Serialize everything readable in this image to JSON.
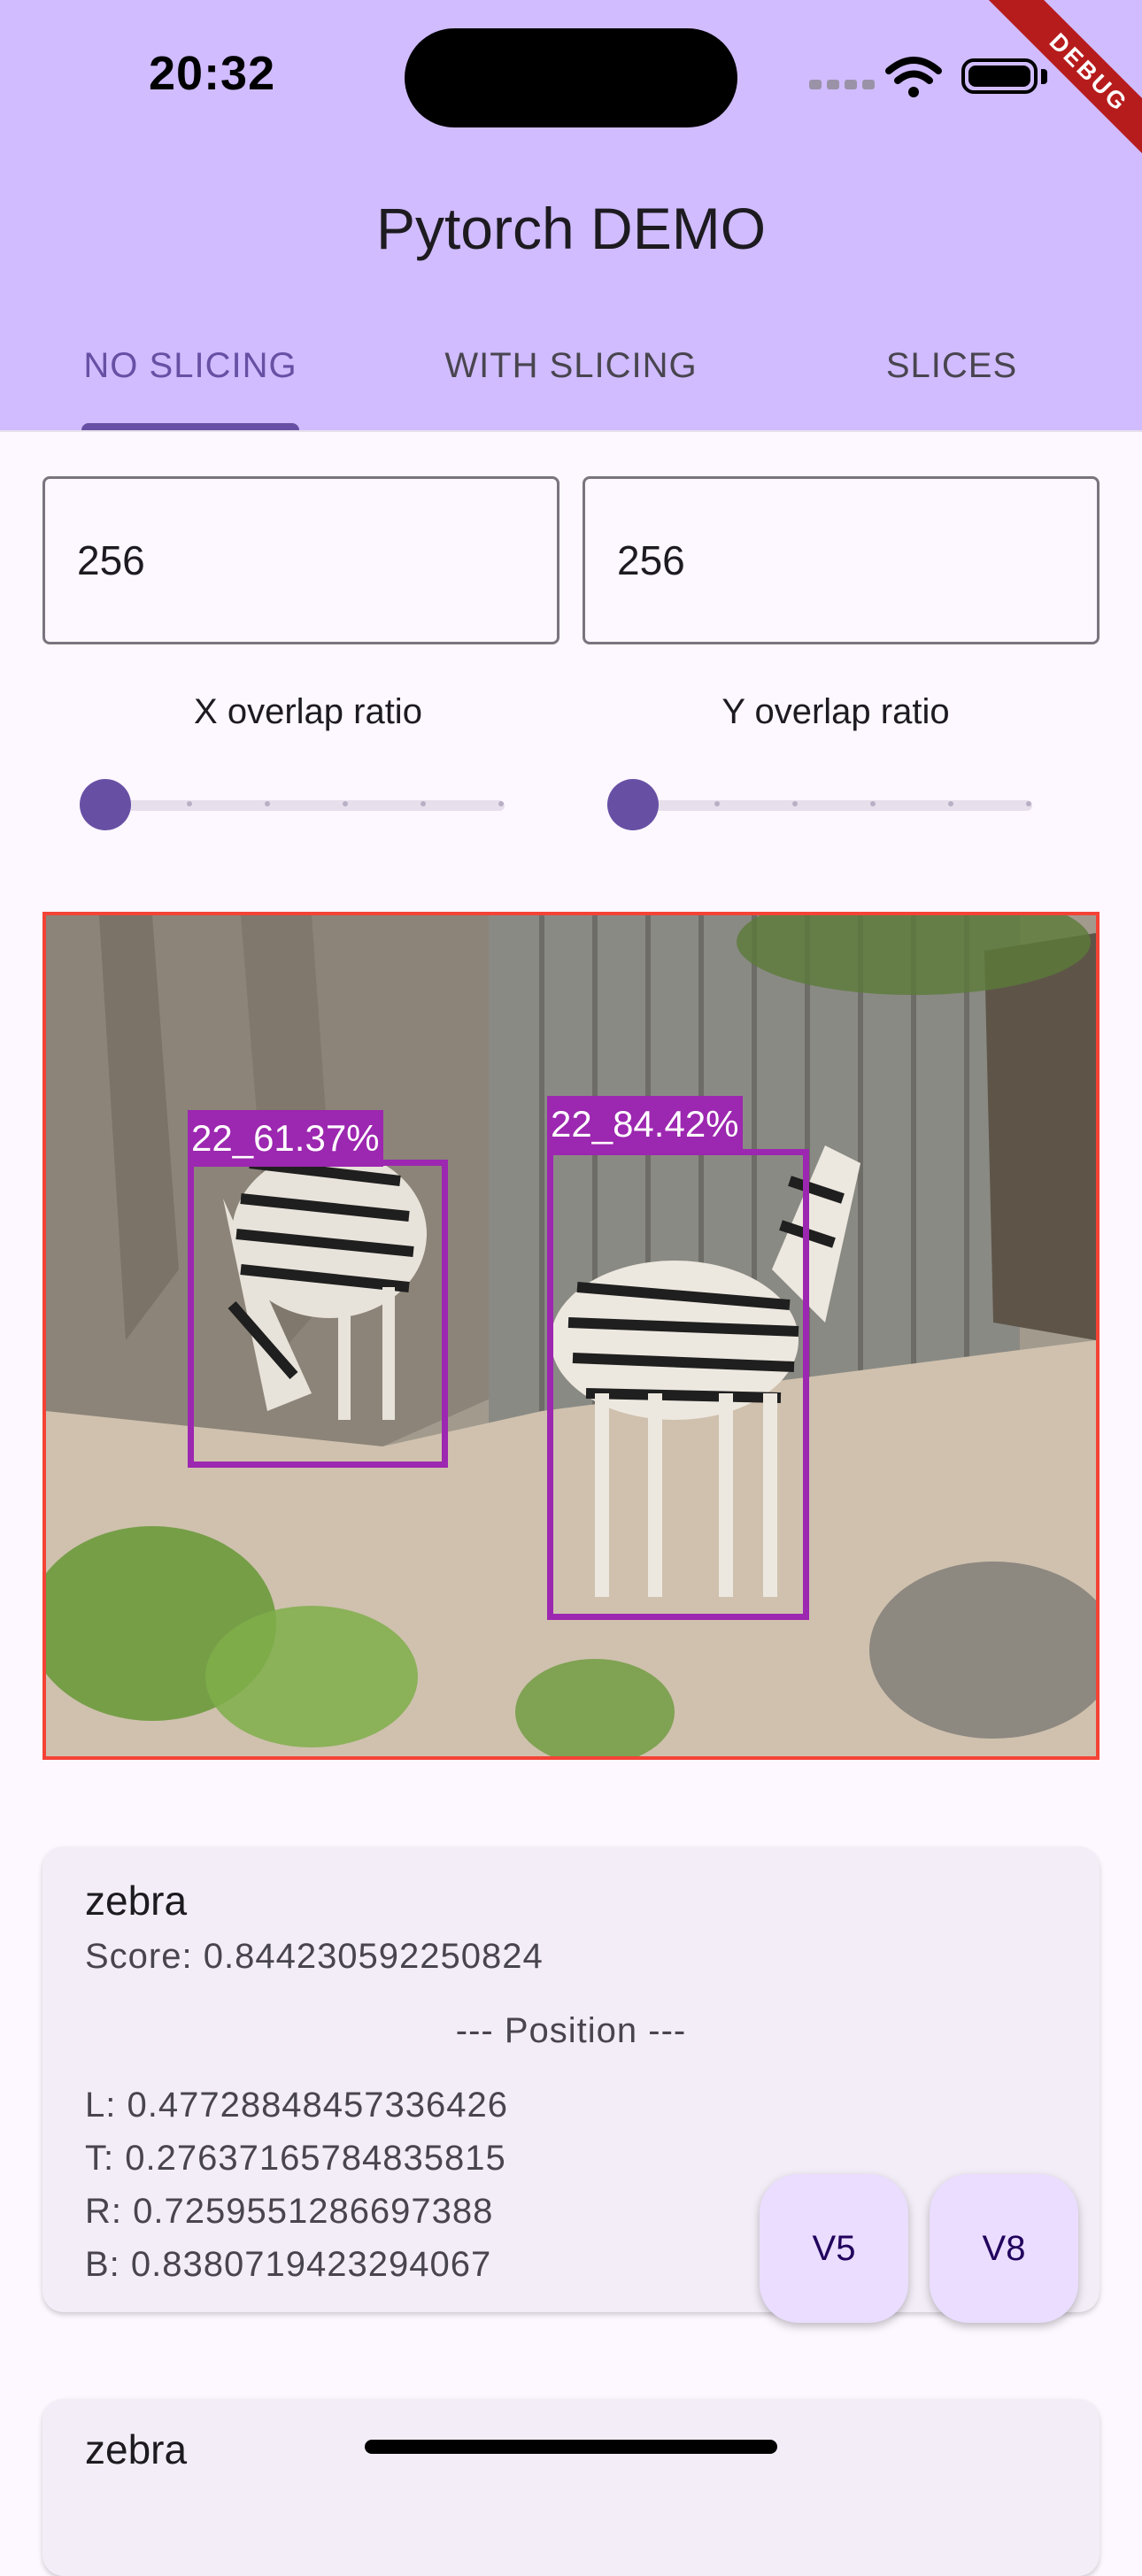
{
  "status_bar": {
    "time": "20:32"
  },
  "debug_banner": "DEBUG",
  "app_bar": {
    "title": "Pytorch DEMO"
  },
  "tabs": [
    {
      "label": "NO SLICING",
      "active": true
    },
    {
      "label": "WITH SLICING",
      "active": false
    },
    {
      "label": "SLICES",
      "active": false
    }
  ],
  "slice_width": {
    "value": "256"
  },
  "slice_height": {
    "value": "256"
  },
  "x_overlap": {
    "label": "X overlap ratio",
    "value_fraction": 0
  },
  "y_overlap": {
    "label": "Y overlap ratio",
    "value_fraction": 0
  },
  "detections": [
    {
      "label": "22_61.37%"
    },
    {
      "label": "22_84.42%"
    }
  ],
  "results": [
    {
      "name": "zebra",
      "score": "Score: 0.844230592250824",
      "position_header": "--- Position ---",
      "left": "L: 0.47728848457336426",
      "top": "T: 0.27637165784835815",
      "right": "R: 0.7259551286697388",
      "bottom": "B: 0.8380719423294067"
    },
    {
      "name": "zebra"
    }
  ],
  "fabs": {
    "v5": "V5",
    "v8": "V8"
  },
  "colors": {
    "app_bar": "#d0bcff",
    "accent": "#6750a4",
    "detection": "#9c27b0",
    "image_border": "#f44336"
  }
}
